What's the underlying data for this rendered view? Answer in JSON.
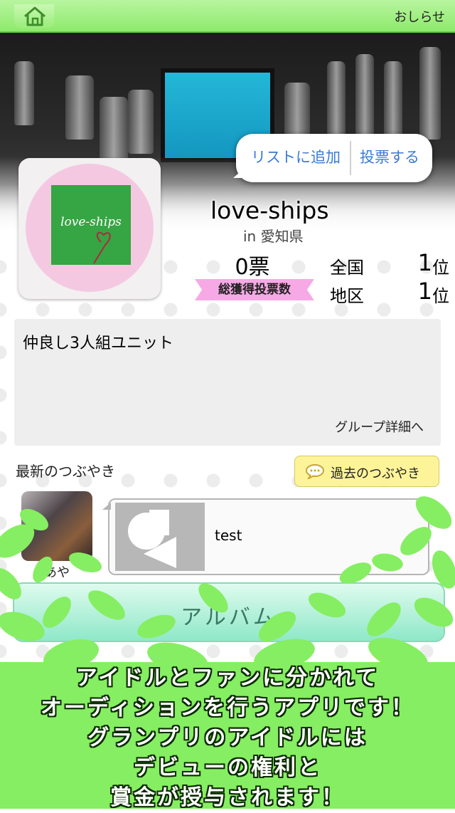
{
  "header": {
    "home_icon": "home-icon",
    "notice_label": "おしらせ"
  },
  "actions": {
    "add_to_list": "リストに追加",
    "vote": "投票する"
  },
  "group": {
    "name": "love-ships",
    "prefecture": "in 愛知県",
    "avatar_text": "love-ships",
    "votes": "0票",
    "votes_label": "総獲得投票数",
    "ranks": [
      {
        "label": "全国",
        "value": "1",
        "unit": "位"
      },
      {
        "label": "地区",
        "value": "1",
        "unit": "位"
      }
    ],
    "description": "仲良し3人組ユニット",
    "detail_link": "グループ詳細へ"
  },
  "tweets": {
    "section_title": "最新のつぶやき",
    "past_button": "過去のつぶやき",
    "past_icon": "speech-bubble-icon",
    "latest": {
      "member_name": "あや",
      "text": "test"
    }
  },
  "album": {
    "label": "アルバム"
  },
  "promo": {
    "lines": [
      "アイドルとファンに分かれて",
      "オーディションを行うアプリです！",
      "グランプリのアイドルには",
      "デビューの権利と",
      "賞金が授与されます！"
    ]
  },
  "colors": {
    "topbar": "#8eea6c",
    "leaf": "#86ee62",
    "link_blue": "#3a7bd6",
    "vote_badge": "#f7a9e6",
    "past_button": "#fdf49a"
  }
}
